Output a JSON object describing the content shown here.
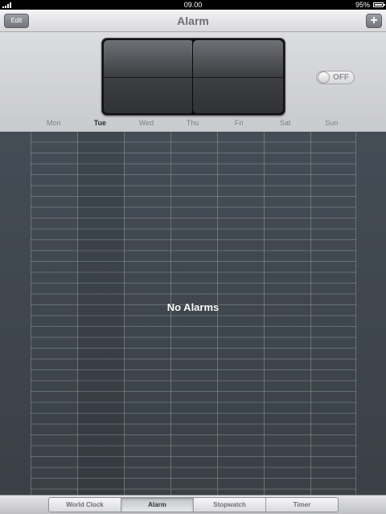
{
  "status_bar": {
    "time": "09.00",
    "battery_percent": "95%",
    "battery_level": 0.95
  },
  "nav": {
    "title": "Alarm",
    "edit_label": "Edit",
    "add_label": "+"
  },
  "alarm_toggle": {
    "label": "OFF",
    "on": false
  },
  "weekdays": [
    "Mon",
    "Tue",
    "Wed",
    "Thu",
    "Fri",
    "Sat",
    "Sun"
  ],
  "current_day": "Tue",
  "empty_message": "No Alarms",
  "tabs": [
    {
      "label": "World Clock",
      "active": false
    },
    {
      "label": "Alarm",
      "active": true
    },
    {
      "label": "Stopwatch",
      "active": false
    },
    {
      "label": "Timer",
      "active": false
    }
  ],
  "colors": {
    "main_background": "#3a4048",
    "status_bar": "#000000"
  }
}
